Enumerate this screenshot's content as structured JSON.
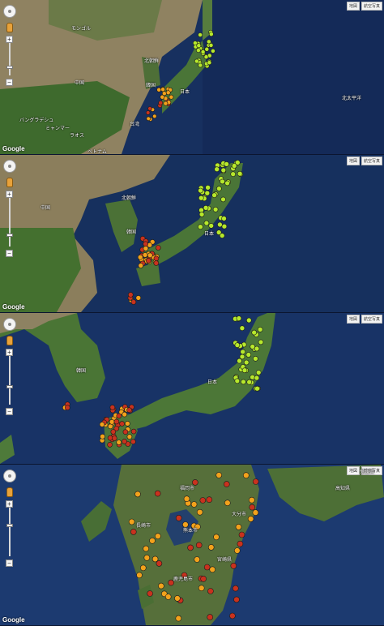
{
  "panels": [
    {
      "google": "Google",
      "labels": [
        "モンゴル",
        "北朝鮮",
        "韓国",
        "中国",
        "日本",
        "台湾",
        "バングラデシュ",
        "ミャンマー",
        "ラオス",
        "ベトナム",
        "北太平洋"
      ],
      "attr": [
        "地図",
        "航空写真"
      ]
    },
    {
      "google": "Google",
      "labels": [
        "北朝鮮",
        "韓国",
        "日本",
        "中国"
      ],
      "attr": [
        "地図",
        "航空写真"
      ]
    },
    {
      "google": "",
      "labels": [
        "韓国",
        "日本"
      ],
      "attr": [
        "地図",
        "航空写真"
      ]
    },
    {
      "google": "Google",
      "labels": [
        "福岡市",
        "長崎市",
        "熊本市",
        "大分市",
        "宮崎県",
        "鹿児島市",
        "愛媛県",
        "高知県"
      ],
      "attr": [
        "地図",
        "航空写真"
      ]
    }
  ],
  "colors": {
    "ocean_deep": "#152c5e",
    "ocean_shallow": "#2d5b96",
    "land_green": "#3d6b2c",
    "land_brown": "#9c8a66",
    "marker_green": "#b6e82c",
    "marker_red": "#c8321e",
    "marker_orange": "#f2a21c"
  }
}
